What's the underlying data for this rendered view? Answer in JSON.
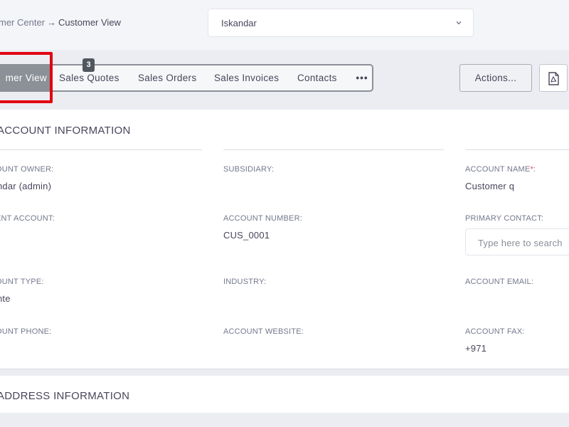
{
  "breadcrumb": {
    "previous": "mer Center",
    "separator": "→",
    "current": "Customer View"
  },
  "user_select": {
    "value": "Iskandar"
  },
  "tabs": [
    {
      "label": "mer View",
      "active": true
    },
    {
      "label": "Sales Quotes",
      "active": false
    },
    {
      "label": "Sales Orders",
      "active": false
    },
    {
      "label": "Sales Invoices",
      "active": false
    },
    {
      "label": "Contacts",
      "active": false
    },
    {
      "label": "•••",
      "active": false
    }
  ],
  "tab_badge": "3",
  "actions_button": "Actions...",
  "pdf_icon": "pdf-file-icon",
  "account_section": {
    "title": "ACCOUNT INFORMATION",
    "fields": {
      "owner": {
        "label": "OUNT OWNER:",
        "value": "ndar (admin)"
      },
      "subsidiary": {
        "label": "SUBSIDIARY:",
        "value": ""
      },
      "account_name": {
        "label": "ACCOUNT NAME",
        "required": "*",
        "colon": ":",
        "value": "Customer q"
      },
      "parent_account": {
        "label": "ENT ACCOUNT:",
        "value": ""
      },
      "account_number": {
        "label": "ACCOUNT NUMBER:",
        "value": "CUS_0001"
      },
      "primary_contact": {
        "label": "PRIMARY CONTACT:",
        "placeholder": "Type here to search"
      },
      "account_type": {
        "label": "OUNT TYPE:",
        "value": "nte"
      },
      "industry": {
        "label": "INDUSTRY:",
        "value": ""
      },
      "account_email": {
        "label": "ACCOUNT EMAIL:",
        "value": ""
      },
      "account_phone": {
        "label": "OUNT PHONE:",
        "value": ""
      },
      "account_website": {
        "label": "ACCOUNT WEBSITE:",
        "value": ""
      },
      "account_fax": {
        "label": "ACCOUNT FAX:",
        "value": "+971"
      }
    }
  },
  "address_section": {
    "title": "ADDRESS INFORMATION"
  },
  "colors": {
    "highlight": "#e1000f",
    "active_tab": "#8c9097",
    "required": "#fd397a"
  }
}
